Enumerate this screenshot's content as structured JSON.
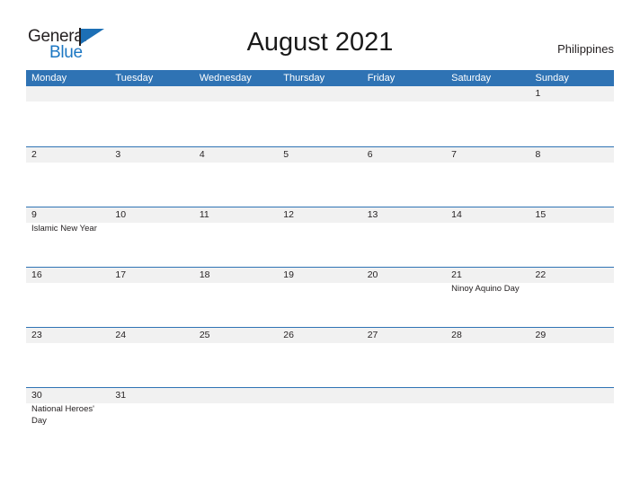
{
  "brand": {
    "name_part1": "General",
    "name_part2": "Blue",
    "flag_icon": "blue-flag-triangle"
  },
  "header": {
    "title": "August 2021",
    "country": "Philippines"
  },
  "colors": {
    "header_blue": "#2f73b4",
    "row_line_blue": "#2f73b4",
    "band_gray": "#f1f1f1",
    "logo_blue": "#1c77c3",
    "text_dark": "#231f20"
  },
  "calendar": {
    "month": "August",
    "year": "2021",
    "weekday_headers": [
      "Monday",
      "Tuesday",
      "Wednesday",
      "Thursday",
      "Friday",
      "Saturday",
      "Sunday"
    ],
    "weeks": [
      [
        {
          "day": "",
          "holiday": ""
        },
        {
          "day": "",
          "holiday": ""
        },
        {
          "day": "",
          "holiday": ""
        },
        {
          "day": "",
          "holiday": ""
        },
        {
          "day": "",
          "holiday": ""
        },
        {
          "day": "",
          "holiday": ""
        },
        {
          "day": "1",
          "holiday": ""
        }
      ],
      [
        {
          "day": "2",
          "holiday": ""
        },
        {
          "day": "3",
          "holiday": ""
        },
        {
          "day": "4",
          "holiday": ""
        },
        {
          "day": "5",
          "holiday": ""
        },
        {
          "day": "6",
          "holiday": ""
        },
        {
          "day": "7",
          "holiday": ""
        },
        {
          "day": "8",
          "holiday": ""
        }
      ],
      [
        {
          "day": "9",
          "holiday": "Islamic New Year"
        },
        {
          "day": "10",
          "holiday": ""
        },
        {
          "day": "11",
          "holiday": ""
        },
        {
          "day": "12",
          "holiday": ""
        },
        {
          "day": "13",
          "holiday": ""
        },
        {
          "day": "14",
          "holiday": ""
        },
        {
          "day": "15",
          "holiday": ""
        }
      ],
      [
        {
          "day": "16",
          "holiday": ""
        },
        {
          "day": "17",
          "holiday": ""
        },
        {
          "day": "18",
          "holiday": ""
        },
        {
          "day": "19",
          "holiday": ""
        },
        {
          "day": "20",
          "holiday": ""
        },
        {
          "day": "21",
          "holiday": "Ninoy Aquino Day"
        },
        {
          "day": "22",
          "holiday": ""
        }
      ],
      [
        {
          "day": "23",
          "holiday": ""
        },
        {
          "day": "24",
          "holiday": ""
        },
        {
          "day": "25",
          "holiday": ""
        },
        {
          "day": "26",
          "holiday": ""
        },
        {
          "day": "27",
          "holiday": ""
        },
        {
          "day": "28",
          "holiday": ""
        },
        {
          "day": "29",
          "holiday": ""
        }
      ],
      [
        {
          "day": "30",
          "holiday": "National Heroes' Day"
        },
        {
          "day": "31",
          "holiday": ""
        },
        {
          "day": "",
          "holiday": ""
        },
        {
          "day": "",
          "holiday": ""
        },
        {
          "day": "",
          "holiday": ""
        },
        {
          "day": "",
          "holiday": ""
        },
        {
          "day": "",
          "holiday": ""
        }
      ]
    ]
  }
}
